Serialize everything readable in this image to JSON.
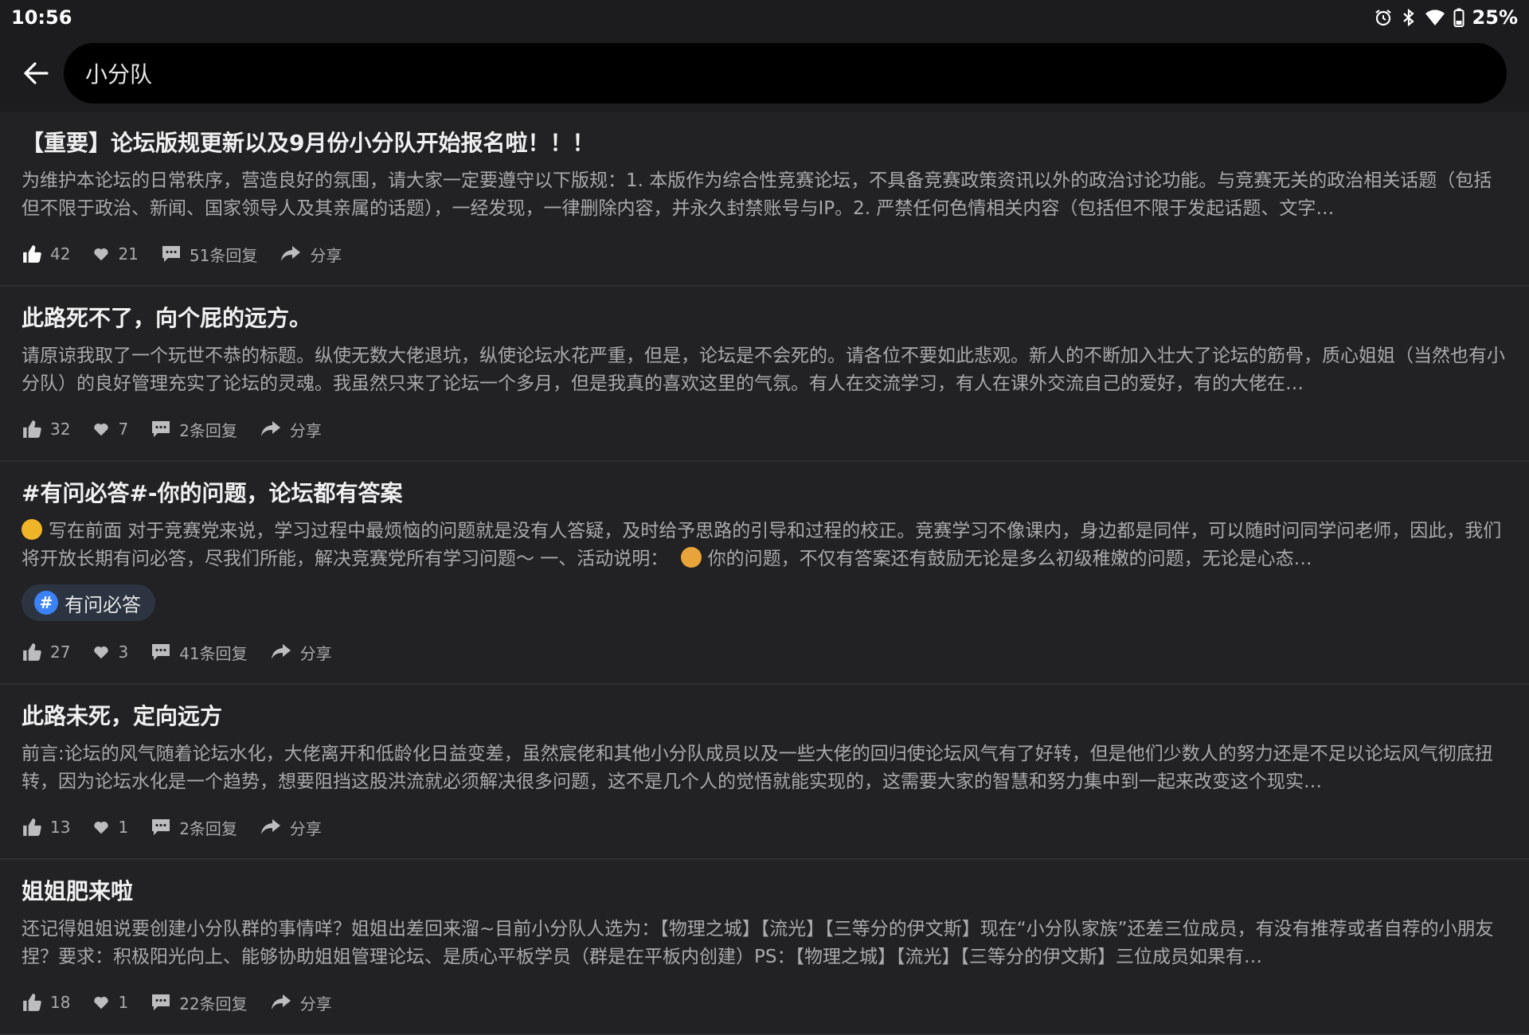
{
  "status_bar": {
    "time": "10:56",
    "battery": "25%",
    "icons": [
      "alarm-icon",
      "bluetooth-icon",
      "wifi-icon",
      "battery-icon"
    ]
  },
  "search": {
    "query": "小分队",
    "back_icon": "arrow-left-icon"
  },
  "posts": [
    {
      "title": "【重要】论坛版规更新以及9月份小分队开始报名啦！！！",
      "excerpt": "为维护本论坛的日常秩序，营造良好的氛围，请大家一定要遵守以下版规：1. 本版作为综合性竞赛论坛，不具备竞赛政策资讯以外的政治讨论功能。与竞赛无关的政治相关话题（包括但不限于政治、新闻、国家领导人及其亲属的话题），一经发现，一律删除内容，并永久封禁账号与IP。2. 严禁任何色情相关内容（包括但不限于发起话题、文字…",
      "likes": "42",
      "hearts": "21",
      "replies": "51条回复",
      "share": "分享"
    },
    {
      "title": "此路死不了，向个屁的远方。",
      "excerpt": "请原谅我取了一个玩世不恭的标题。纵使无数大佬退坑，纵使论坛水花严重，但是，论坛是不会死的。请各位不要如此悲观。新人的不断加入壮大了论坛的筋骨，质心姐姐（当然也有小分队）的良好管理充实了论坛的灵魂。我虽然只来了论坛一个多月，但是我真的喜欢这里的气氛。有人在交流学习，有人在课外交流自己的爱好，有的大佬在…",
      "likes": "32",
      "hearts": "7",
      "replies": "2条回复",
      "share": "分享"
    },
    {
      "title": "#有问必答#-你的问题，论坛都有答案",
      "excerpt_a": "写在前面 对于竞赛党来说，学习过程中最烦恼的问题就是没有人答疑，及时给予思路的引导和过程的校正。竞赛学习不像课内，身边都是同伴，可以随时问同学问老师，因此，我们将开放长期有问必答，尽我们所能，解决竞赛党所有学习问题～ 一、活动说明：",
      "excerpt_b": "你的问题，不仅有答案还有鼓励无论是多么初级稚嫩的问题，无论是心态…",
      "tag": "有问必答",
      "likes": "27",
      "hearts": "3",
      "replies": "41条回复",
      "share": "分享"
    },
    {
      "title": "此路未死，定向远方",
      "excerpt": "前言:论坛的风气随着论坛水化，大佬离开和低龄化日益变差，虽然宸佬和其他小分队成员以及一些大佬的回归使论坛风气有了好转，但是他们少数人的努力还是不足以论坛风气彻底扭转，因为论坛水化是一个趋势，想要阻挡这股洪流就必须解决很多问题，这不是几个人的觉悟就能实现的，这需要大家的智慧和努力集中到一起来改变这个现实…",
      "likes": "13",
      "hearts": "1",
      "replies": "2条回复",
      "share": "分享"
    },
    {
      "title": "姐姐肥来啦",
      "excerpt": "还记得姐姐说要创建小分队群的事情咩？姐姐出差回来溜~目前小分队人选为：【物理之城】【流光】【三等分的伊文斯】现在“小分队家族”还差三位成员，有没有推荐或者自荐的小朋友捏？要求：积极阳光向上、能够协助姐姐管理论坛、是质心平板学员（群是在平板内创建）PS：【物理之城】【流光】【三等分的伊文斯】三位成员如果有…",
      "likes": "18",
      "hearts": "1",
      "replies": "22条回复",
      "share": "分享"
    }
  ]
}
